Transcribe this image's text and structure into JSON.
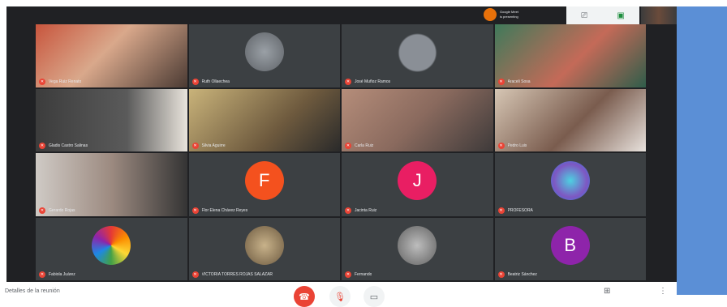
{
  "presenter_chip": {
    "line1": "Google Meet",
    "line2": "is presenting"
  },
  "topbar": {
    "caption_icon": "cc-icon",
    "share_icon": "present-icon"
  },
  "bottombar": {
    "meeting_details": "Detalles de la reunión",
    "end_icon": "call-end-icon",
    "mic_icon": "mic-off-icon",
    "cam_icon": "camera-icon"
  },
  "colors": {
    "meet_bg": "#202124",
    "tile_bg": "#3c4043",
    "mute_red": "#ea4335",
    "side_blue": "#5b8fd6",
    "orange": "#f4511e",
    "pink": "#e91e63",
    "purple": "#8e24aa"
  },
  "tiles": [
    {
      "name": "Vega Ruiz Renato",
      "type": "video"
    },
    {
      "name": "Ruth Ollaechea",
      "type": "photo"
    },
    {
      "name": "José Muñoz Ramos",
      "type": "video"
    },
    {
      "name": "Araceli Sosa",
      "type": "video"
    },
    {
      "name": "Gladis Castro Salinas",
      "type": "video"
    },
    {
      "name": "Silvia Aguirre",
      "type": "video"
    },
    {
      "name": "Carla Ruiz",
      "type": "video"
    },
    {
      "name": "Pedro Luis",
      "type": "video"
    },
    {
      "name": "Gerardo Rojas",
      "type": "video"
    },
    {
      "name": "Flor Elena Chávez Reyes",
      "type": "letter",
      "letter": "F",
      "color": "#f4511e"
    },
    {
      "name": "Jacinta Ruiz",
      "type": "letter",
      "letter": "J",
      "color": "#e91e63"
    },
    {
      "name": "PROFESORA",
      "type": "photo"
    },
    {
      "name": "Fabiola Juárez",
      "type": "photo"
    },
    {
      "name": "VICTORIA TORRES ROJAS SALAZAR",
      "type": "photo"
    },
    {
      "name": "Fernando",
      "type": "photo"
    },
    {
      "name": "Beatriz Sánchez",
      "type": "letter",
      "letter": "B",
      "color": "#8e24aa"
    }
  ]
}
